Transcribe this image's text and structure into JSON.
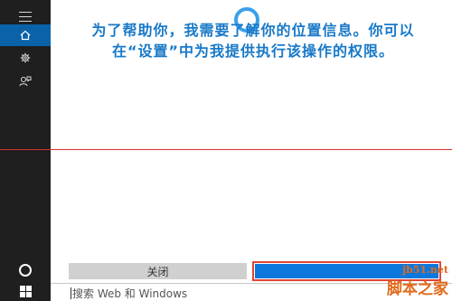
{
  "cortana_panel": {
    "message": "为了帮助你，我需要了解你的位置信息。你可以在“设置”中为我提供执行该操作的权限。",
    "close_button_label": "关闭",
    "settings_button_label": ""
  },
  "search": {
    "placeholder": "搜索 Web 和 Windows"
  },
  "sidebar": {
    "items": [
      {
        "icon": "menu-icon"
      },
      {
        "icon": "home-icon",
        "active": true
      },
      {
        "icon": "gear-icon"
      },
      {
        "icon": "feedback-icon"
      }
    ]
  },
  "watermark": {
    "url": "jb51.net",
    "name": "脚本之家"
  },
  "colors": {
    "accent": "#0d78dc",
    "message_text": "#1879c8",
    "highlight": "#e34434",
    "rail": "#1f1f1f"
  }
}
